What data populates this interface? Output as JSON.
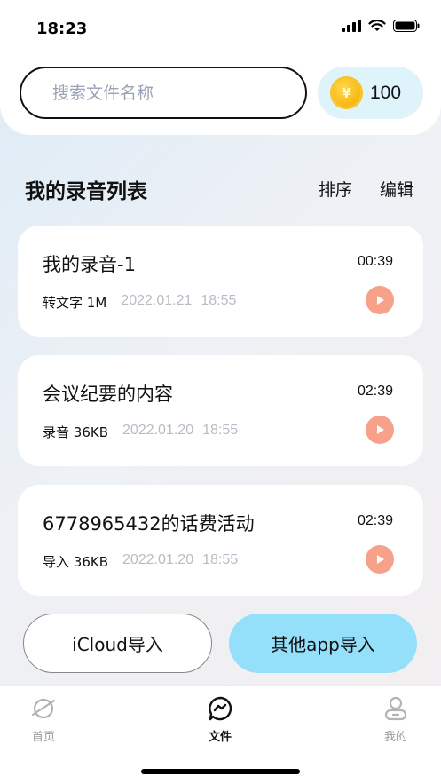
{
  "status_bar": {
    "time": "18:23"
  },
  "search": {
    "placeholder": "搜索文件名称"
  },
  "coins": {
    "count": "100",
    "symbol": "¥"
  },
  "section": {
    "title": "我的录音列表",
    "sort_label": "排序",
    "edit_label": "编辑"
  },
  "recordings": [
    {
      "title": "我的录音-1",
      "duration": "00:39",
      "tag": "转文字",
      "size": "1M",
      "date": "2022.01.21",
      "time": "18:55"
    },
    {
      "title": "会议纪要的内容",
      "duration": "02:39",
      "tag": "录音",
      "size": "36KB",
      "date": "2022.01.20",
      "time": "18:55"
    },
    {
      "title": "6778965432的话费活动",
      "duration": "02:39",
      "tag": "导入",
      "size": "36KB",
      "date": "2022.01.20",
      "time": "18:55"
    }
  ],
  "actions": {
    "icloud_label": "iCloud导入",
    "other_label": "其他app导入"
  },
  "tabs": [
    {
      "label": "首页",
      "icon": "planet-icon",
      "active": false
    },
    {
      "label": "文件",
      "icon": "messenger-icon",
      "active": true
    },
    {
      "label": "我的",
      "icon": "person-icon",
      "active": false
    }
  ],
  "colors": {
    "accent": "#94dffa",
    "play": "#f7a08a",
    "inactive_tab": "#9a9a9a"
  }
}
